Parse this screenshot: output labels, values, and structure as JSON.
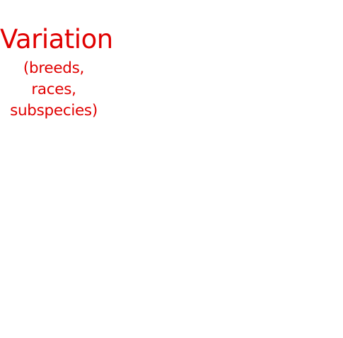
{
  "label": {
    "title": "Variation",
    "subtitle_line1": "(breeds, races,",
    "subtitle_line2": "subspecies)"
  },
  "colors": {
    "text": "#e00000",
    "background": "#ffffff"
  }
}
